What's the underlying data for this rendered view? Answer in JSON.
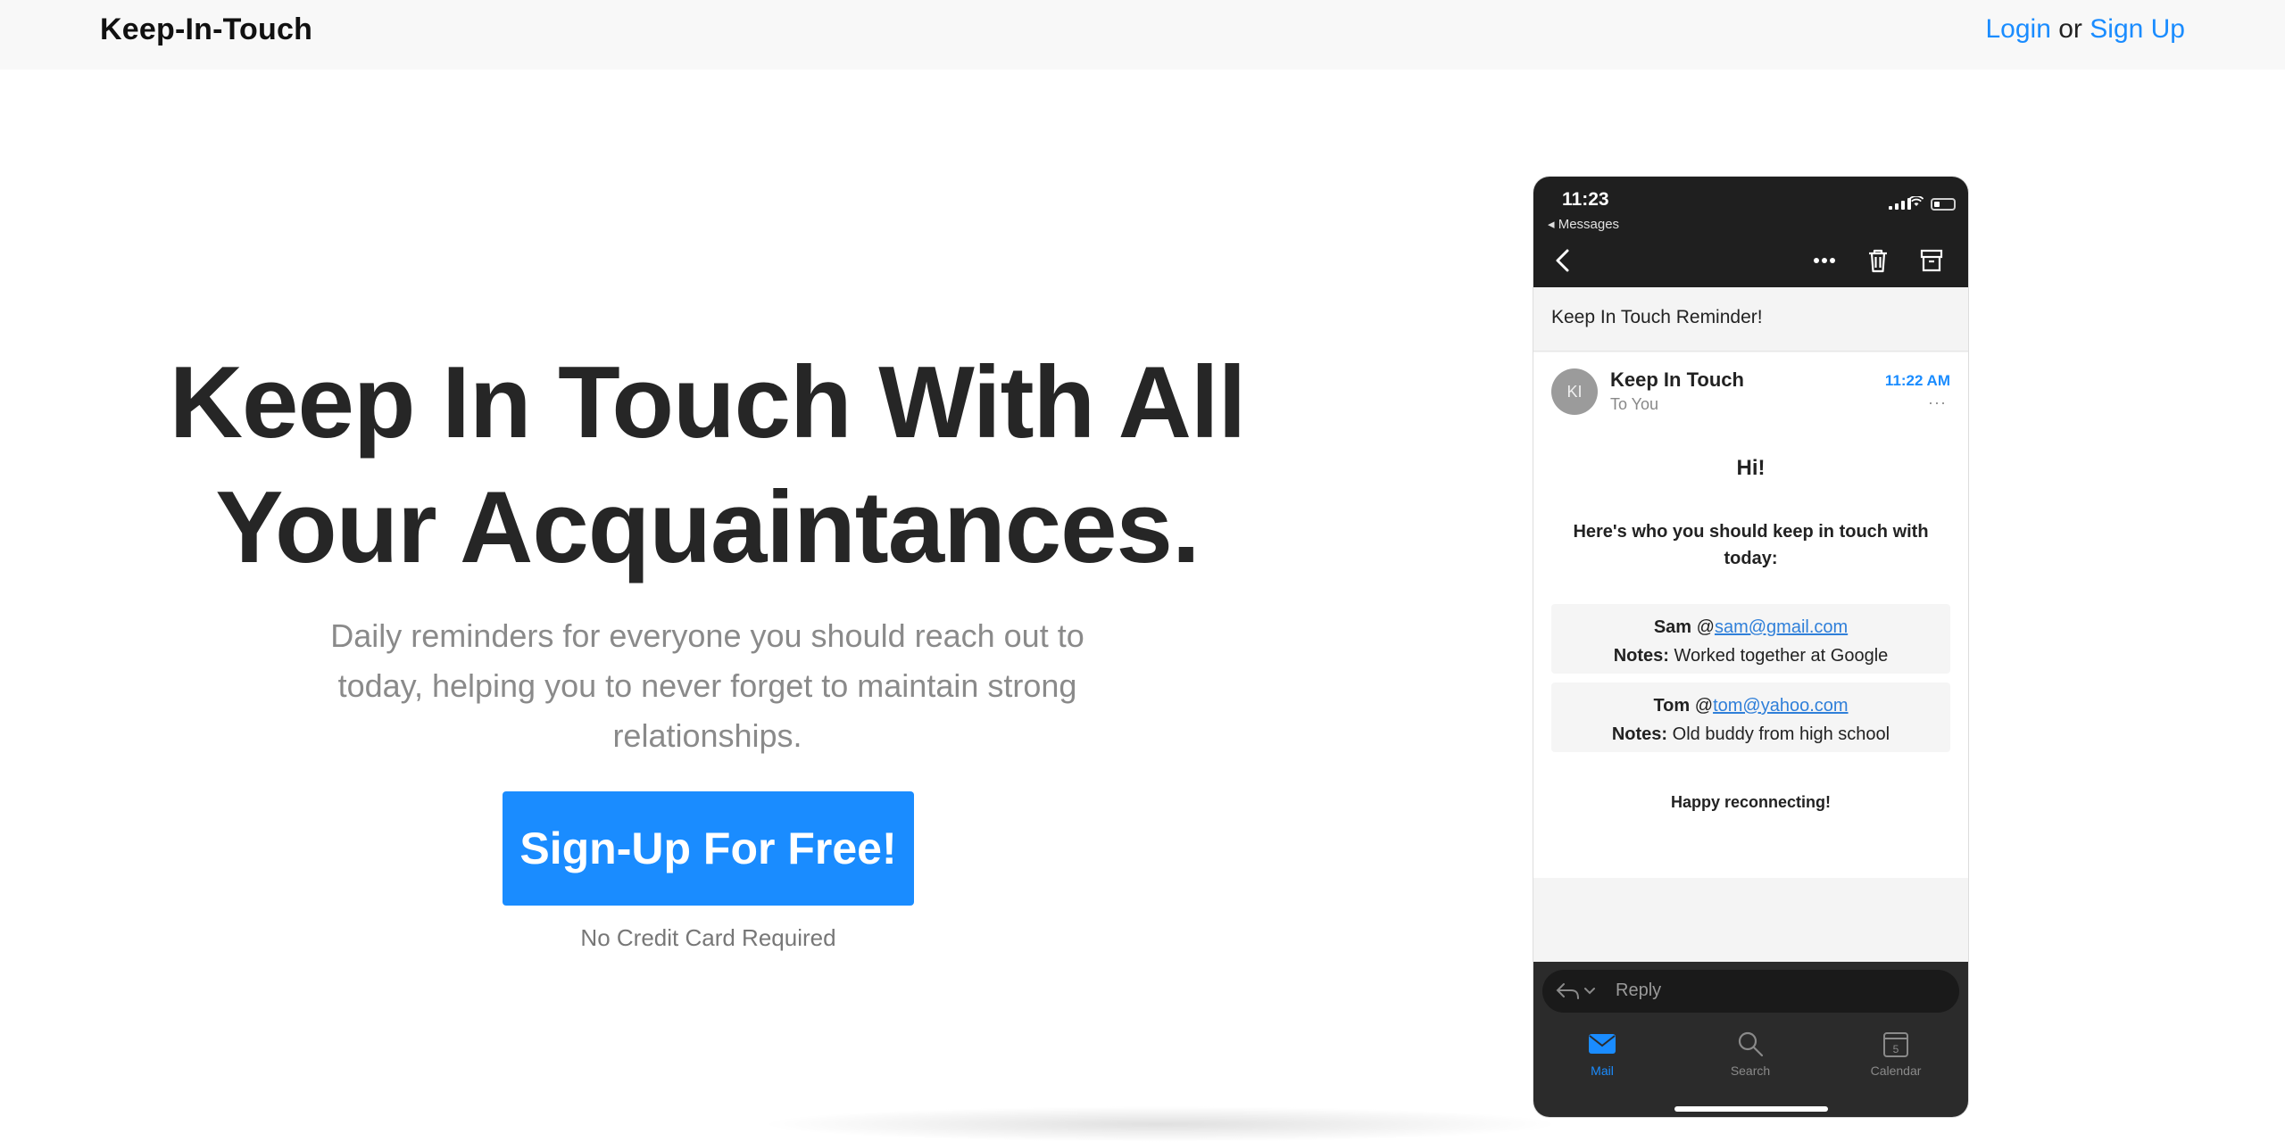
{
  "navbar": {
    "brand": "Keep-In-Touch",
    "login_label": "Login",
    "or_text": "or",
    "signup_label": "Sign Up"
  },
  "hero": {
    "title_line1": "Keep In Touch With All",
    "title_line2": "Your Acquaintances.",
    "subtitle": "Daily reminders for everyone you should reach out to today, helping you to never forget to maintain strong relationships.",
    "cta_label": "Sign-Up For Free!",
    "cta_note": "No Credit Card Required"
  },
  "phone": {
    "status": {
      "time": "11:23",
      "back_app": "◂ Messages"
    },
    "subject": "Keep In Touch Reminder!",
    "email": {
      "avatar_initials": "KI",
      "sender": "Keep In Touch",
      "recipient": "To You",
      "time": "11:22 AM",
      "more": "···",
      "greeting": "Hi!",
      "intro": "Here's who you should keep in touch with today:",
      "contacts": [
        {
          "name": "Sam",
          "at": "@",
          "email": "sam@gmail.com",
          "notes_label": "Notes:",
          "notes": "Worked together at Google"
        },
        {
          "name": "Tom",
          "at": "@",
          "email": "tom@yahoo.com",
          "notes_label": "Notes:",
          "notes": "Old buddy from high school"
        }
      ],
      "closing": "Happy reconnecting!"
    },
    "reply_placeholder": "Reply",
    "tabs": [
      {
        "label": "Mail",
        "icon": "mail-icon"
      },
      {
        "label": "Search",
        "icon": "search-icon"
      },
      {
        "label": "Calendar",
        "icon": "calendar-icon",
        "day": "5"
      }
    ],
    "colors": {
      "accent": "#1a8cff",
      "dark": "#1f1f1f"
    }
  }
}
